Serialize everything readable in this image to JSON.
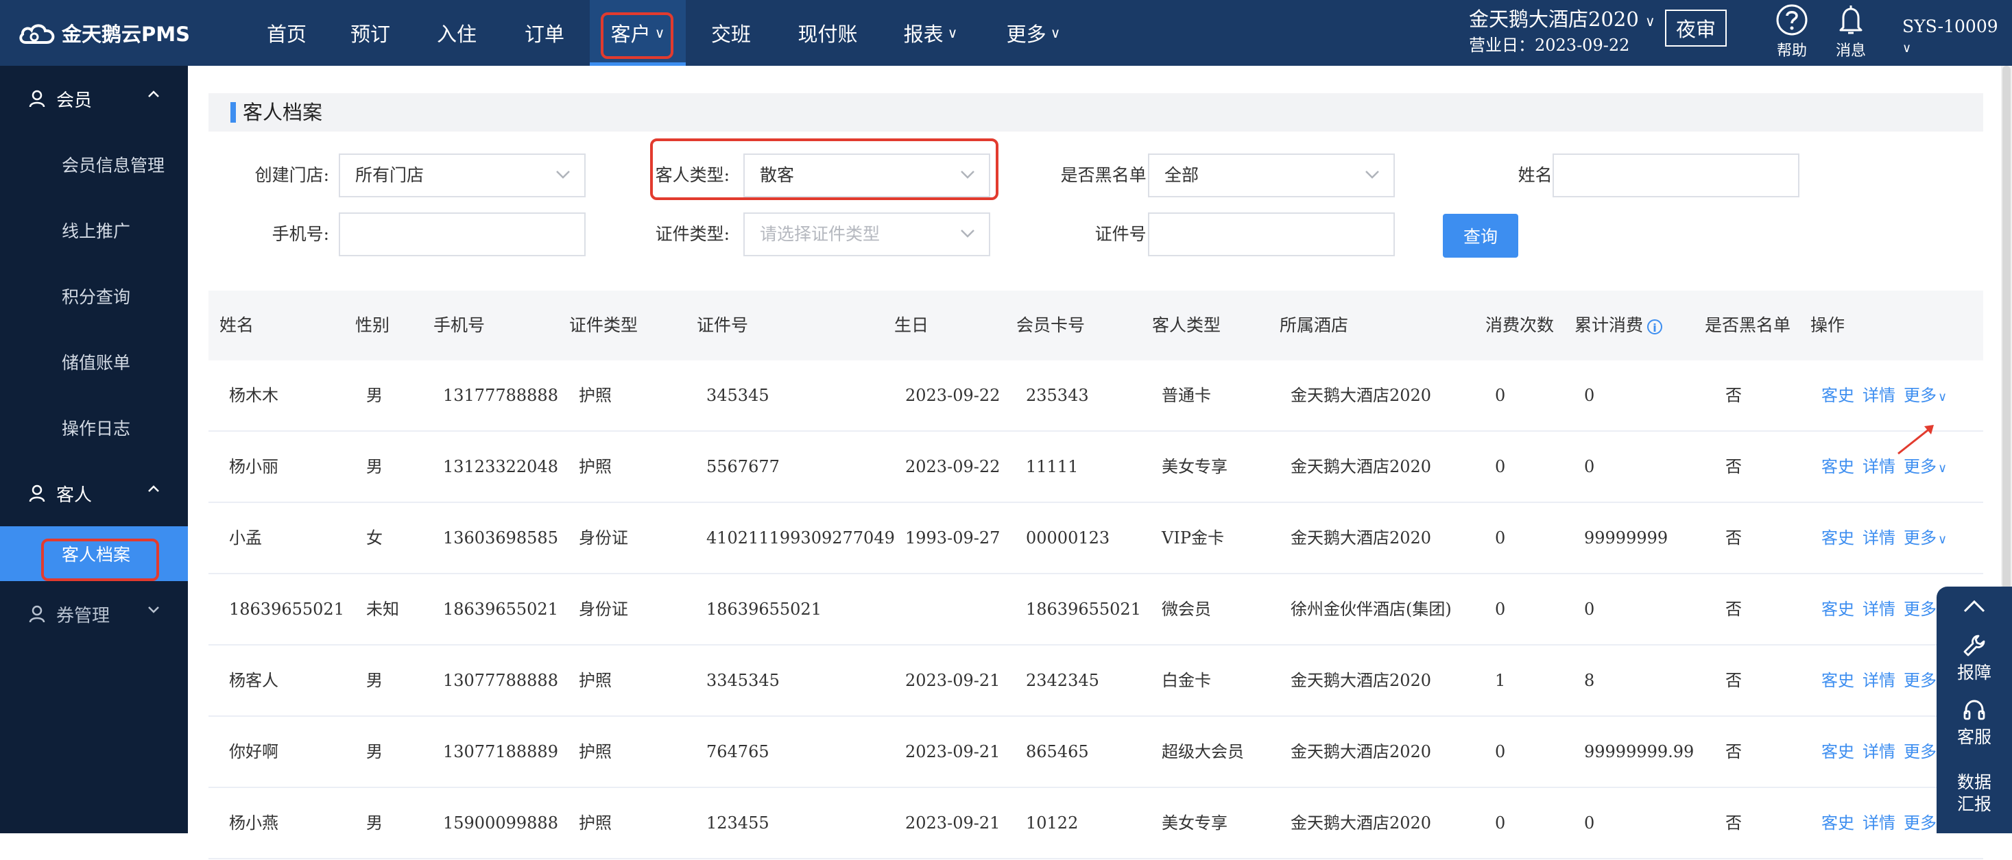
{
  "app": {
    "logo_text": "金天鹅云PMS"
  },
  "nav": [
    {
      "label": "首页",
      "chevron": false
    },
    {
      "label": "预订",
      "chevron": false
    },
    {
      "label": "入住",
      "chevron": false
    },
    {
      "label": "订单",
      "chevron": false
    },
    {
      "label": "客户",
      "chevron": true,
      "active": true
    },
    {
      "label": "交班",
      "chevron": false
    },
    {
      "label": "现付账",
      "chevron": false
    },
    {
      "label": "报表",
      "chevron": true
    },
    {
      "label": "更多",
      "chevron": true
    }
  ],
  "header": {
    "hotel_name": "金天鹅大酒店2020",
    "business_date": "营业日：2023-09-22",
    "night_audit": "夜审",
    "help": "帮助",
    "messages": "消息",
    "user": "SYS-10009"
  },
  "sidebar": {
    "groups": [
      {
        "label": "会员",
        "expanded": true,
        "items": [
          "会员信息管理",
          "线上推广",
          "积分查询",
          "储值账单",
          "操作日志"
        ]
      },
      {
        "label": "客人",
        "expanded": true,
        "items": [
          "客人档案"
        ],
        "active_item": "客人档案"
      },
      {
        "label": "券管理",
        "expanded": false,
        "items": []
      }
    ]
  },
  "page": {
    "title": "客人档案"
  },
  "filters": {
    "store_label": "创建门店:",
    "store_value": "所有门店",
    "guest_type_label": "客人类型:",
    "guest_type_value": "散客",
    "blacklist_label": "是否黑名单:",
    "blacklist_value": "全部",
    "name_label": "姓名:",
    "name_value": "",
    "phone_label": "手机号:",
    "phone_value": "",
    "id_type_label": "证件类型:",
    "id_type_placeholder": "请选择证件类型",
    "id_no_label": "证件号:",
    "id_no_value": "",
    "query_button": "查询"
  },
  "table": {
    "columns": [
      "姓名",
      "性别",
      "手机号",
      "证件类型",
      "证件号",
      "生日",
      "会员卡号",
      "客人类型",
      "所属酒店",
      "消费次数",
      "累计消费",
      "是否黑名单",
      "操作"
    ],
    "info_icon": "i",
    "actions": {
      "history": "客史",
      "detail": "详情",
      "more": "更多"
    },
    "rows": [
      [
        "杨木木",
        "男",
        "13177788888",
        "护照",
        "345345",
        "2023-09-22",
        "235343",
        "普通卡",
        "金天鹅大酒店2020",
        "0",
        "0",
        "否"
      ],
      [
        "杨小丽",
        "男",
        "13123322048",
        "护照",
        "5567677",
        "2023-09-22",
        "11111",
        "美女专享",
        "金天鹅大酒店2020",
        "0",
        "0",
        "否"
      ],
      [
        "小孟",
        "女",
        "13603698585",
        "身份证",
        "410211199309277049",
        "1993-09-27",
        "00000123",
        "VIP金卡",
        "金天鹅大酒店2020",
        "0",
        "99999999",
        "否"
      ],
      [
        "18639655021",
        "未知",
        "18639655021",
        "身份证",
        "18639655021",
        "",
        "18639655021",
        "微会员",
        "徐州金伙伴酒店(集团)",
        "0",
        "0",
        "否"
      ],
      [
        "杨客人",
        "男",
        "13077788888",
        "护照",
        "3345345",
        "2023-09-21",
        "2342345",
        "白金卡",
        "金天鹅大酒店2020",
        "1",
        "8",
        "否"
      ],
      [
        "你好啊",
        "男",
        "13077188889",
        "护照",
        "764765",
        "2023-09-21",
        "865465",
        "超级大会员",
        "金天鹅大酒店2020",
        "0",
        "99999999.99",
        "否"
      ],
      [
        "杨小燕",
        "男",
        "15900099888",
        "护照",
        "123455",
        "2023-09-21",
        "10122",
        "美女专享",
        "金天鹅大酒店2020",
        "0",
        "0",
        "否"
      ]
    ]
  },
  "float_panel": {
    "report": "报障",
    "service": "客服",
    "data_line1": "数据",
    "data_line2": "汇报"
  },
  "colors": {
    "topbar": "#1a3a66",
    "sidebar": "#0e1f38",
    "accent": "#3d8ef0",
    "highlight": "#e23b2e"
  }
}
